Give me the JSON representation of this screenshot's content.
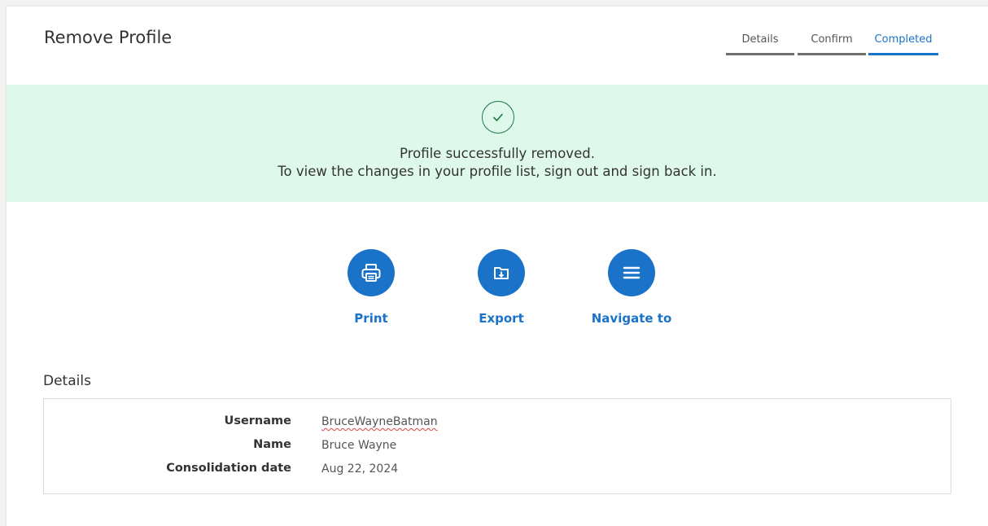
{
  "header": {
    "title": "Remove Profile"
  },
  "stepper": {
    "steps": [
      {
        "label": "Details",
        "state": "done"
      },
      {
        "label": "Confirm",
        "state": "done"
      },
      {
        "label": "Completed",
        "state": "active"
      }
    ]
  },
  "banner": {
    "icon": "check-circle-icon",
    "line1": "Profile successfully removed.",
    "line2": "To view the changes in your profile list, sign out and sign back in.",
    "background_color": "#dff8ec"
  },
  "actions": [
    {
      "label": "Print",
      "icon": "printer-icon"
    },
    {
      "label": "Export",
      "icon": "export-folder-icon"
    },
    {
      "label": "Navigate to",
      "icon": "menu-icon"
    }
  ],
  "details": {
    "heading": "Details",
    "rows": [
      {
        "label": "Username",
        "value": "BruceWayneBatman"
      },
      {
        "label": "Name",
        "value": "Bruce Wayne"
      },
      {
        "label": "Consolidation date",
        "value": "Aug 22, 2024"
      }
    ]
  },
  "colors": {
    "accent": "#1a73c8",
    "success_text": "#1e7a44"
  }
}
